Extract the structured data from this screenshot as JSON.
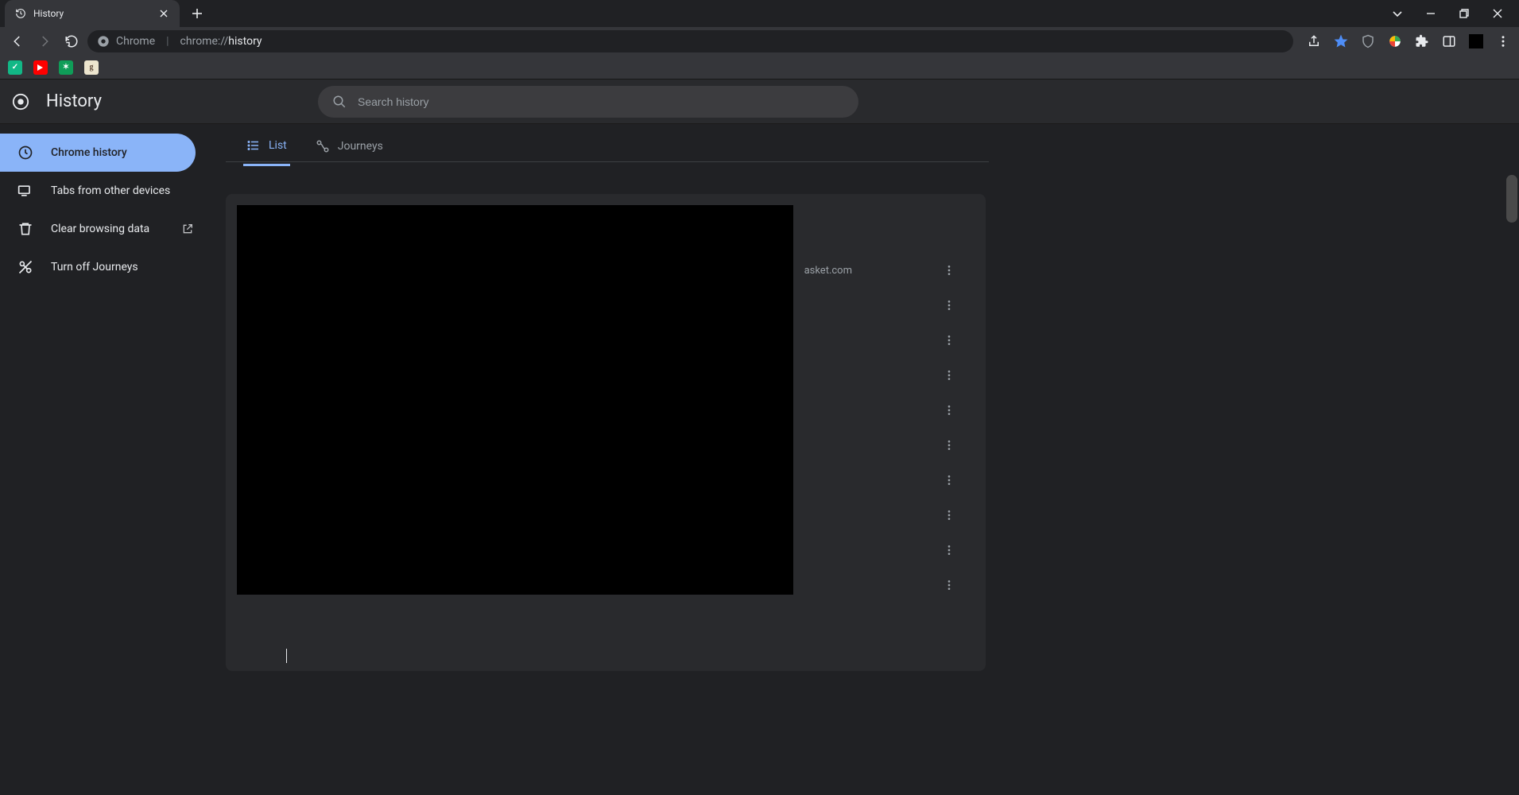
{
  "tab": {
    "title": "History"
  },
  "omnibox": {
    "prefix": "Chrome",
    "url_dim": "chrome://",
    "url_bright": "history"
  },
  "page": {
    "title": "History"
  },
  "search": {
    "placeholder": "Search history"
  },
  "sidebar": {
    "items": [
      {
        "label": "Chrome history"
      },
      {
        "label": "Tabs from other devices"
      },
      {
        "label": "Clear browsing data"
      },
      {
        "label": "Turn off Journeys"
      }
    ]
  },
  "view_tabs": {
    "list": "List",
    "journeys": "Journeys"
  },
  "visible_history_fragments": {
    "row0_domain": "asket.com"
  },
  "row_count": 10
}
